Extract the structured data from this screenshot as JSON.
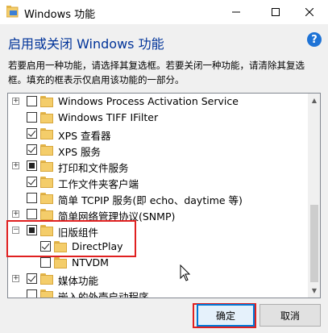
{
  "window": {
    "title": "Windows 功能"
  },
  "header": {
    "heading": "启用或关闭 Windows 功能",
    "help": "?",
    "description": "若要启用一种功能，请选择其复选框。若要关闭一种功能，请清除其复选框。填充的框表示仅启用该功能的一部分。"
  },
  "features": [
    {
      "label": "Windows Process Activation Service",
      "state": "unchecked",
      "expandable": true
    },
    {
      "label": "Windows TIFF IFilter",
      "state": "unchecked",
      "expandable": false
    },
    {
      "label": "XPS 查看器",
      "state": "checked",
      "expandable": false
    },
    {
      "label": "XPS 服务",
      "state": "checked",
      "expandable": false
    },
    {
      "label": "打印和文件服务",
      "state": "partial",
      "expandable": true
    },
    {
      "label": "工作文件夹客户端",
      "state": "checked",
      "expandable": false
    },
    {
      "label": "简单 TCPIP 服务(即 echo、daytime 等)",
      "state": "unchecked",
      "expandable": false
    },
    {
      "label": "简单网络管理协议(SNMP)",
      "state": "unchecked",
      "expandable": true
    },
    {
      "label": "旧版组件",
      "state": "partial",
      "expandable": true,
      "expanded": true
    },
    {
      "label": "DirectPlay",
      "state": "checked",
      "expandable": false,
      "child": true
    },
    {
      "label": "NTVDM",
      "state": "unchecked",
      "expandable": false,
      "child": true
    },
    {
      "label": "媒体功能",
      "state": "checked",
      "expandable": true
    },
    {
      "label": "嵌入的外壳启动程序",
      "state": "unchecked",
      "expandable": false
    }
  ],
  "buttons": {
    "ok": "确定",
    "cancel": "取消"
  },
  "colors": {
    "accent": "#0078d7",
    "heading": "#003399",
    "highlight": "#e02020"
  }
}
